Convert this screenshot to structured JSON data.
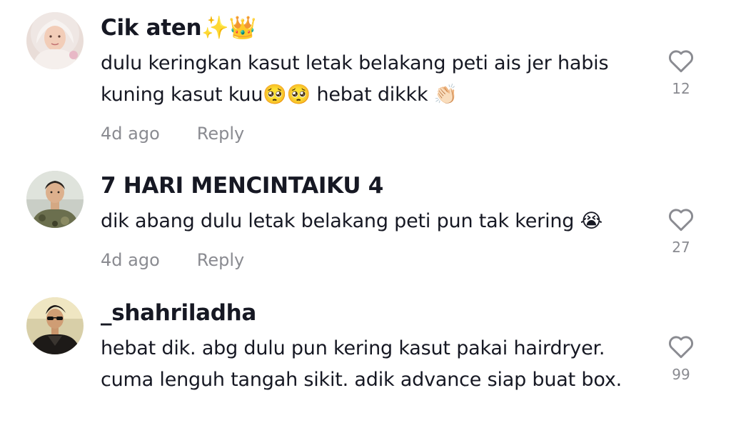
{
  "comments": [
    {
      "username": "Cik aten✨👑",
      "text": "dulu keringkan kasut letak belakang peti ais jer habis kuning kasut kuu🥺🥺 hebat dikkk 👏🏻",
      "time": "4d ago",
      "reply_label": "Reply",
      "likes": "12",
      "avatar_icon": "avatar-hijab-woman",
      "like_icon": "heart-outline-icon"
    },
    {
      "username": "7 HARI MENCINTAIKU 4",
      "text": "dik abang dulu letak belakang peti pun tak kering 😭",
      "time": "4d ago",
      "reply_label": "Reply",
      "likes": "27",
      "avatar_icon": "avatar-man-camouflage",
      "like_icon": "heart-outline-icon"
    },
    {
      "username": "_shahriladha",
      "text": "hebat dik. abg dulu pun kering kasut pakai hairdryer. cuma lenguh tangah sikit. adik advance siap buat box.",
      "time": "",
      "reply_label": "",
      "likes": "99",
      "avatar_icon": "avatar-man-sunglasses",
      "like_icon": "heart-outline-icon"
    }
  ],
  "colors": {
    "text_primary": "#161823",
    "text_secondary": "#8a8b91",
    "background": "#ffffff"
  }
}
